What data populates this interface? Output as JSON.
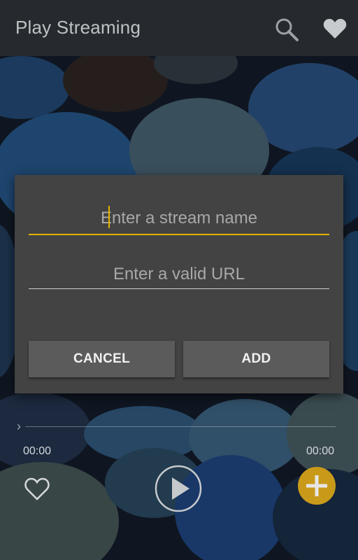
{
  "appbar": {
    "title": "Play Streaming",
    "icons": [
      "search-icon",
      "heart-icon"
    ]
  },
  "dialog": {
    "name_placeholder": "Enter a stream name",
    "url_placeholder": "Enter a valid URL",
    "cancel_label": "CANCEL",
    "add_label": "ADD"
  },
  "player": {
    "time_elapsed": "00:00",
    "time_total": "00:00",
    "progress": 0,
    "icons": [
      "heart-outline-icon",
      "play-icon",
      "plus-icon"
    ]
  },
  "colors": {
    "appbar": "#262a2f",
    "dialog": "#434343",
    "accent": "#e2b300",
    "button": "#5b5b5b",
    "fab": "#c99a1a"
  }
}
